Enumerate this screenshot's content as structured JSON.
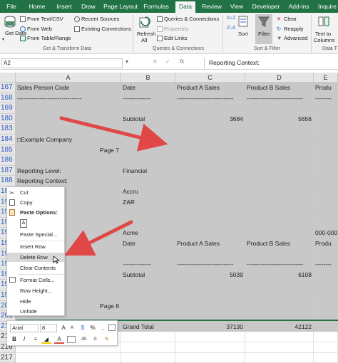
{
  "menu": {
    "tabs": [
      "File",
      "Home",
      "Insert",
      "Draw",
      "Page Layout",
      "Formulas",
      "Data",
      "Review",
      "View",
      "Developer",
      "Add-ins",
      "Inquire"
    ],
    "active": "Data"
  },
  "ribbon": {
    "get_data": "Get Data",
    "from_text_csv": "From Text/CSV",
    "from_web": "From Web",
    "from_table_range": "From Table/Range",
    "recent_sources": "Recent Sources",
    "existing_connections": "Existing Connections",
    "refresh_all_1": "Refresh",
    "refresh_all_2": "All",
    "queries_connections": "Queries & Connections",
    "properties": "Properties",
    "edit_links": "Edit Links",
    "sort": "Sort",
    "filter": "Filter",
    "clear": "Clear",
    "reapply": "Reapply",
    "advanced": "Advanced",
    "text_to_columns_1": "Text to",
    "text_to_columns_2": "Columns",
    "group_get_transform": "Get & Transform Data",
    "group_queries": "Queries & Connections",
    "group_sort_filter": "Sort & Filter",
    "group_data_tools": "Data T"
  },
  "formula_bar": {
    "name_box": "A2",
    "fx": "fx",
    "content": "Reporting Context:"
  },
  "columns": [
    "A",
    "B",
    "C",
    "D",
    "E"
  ],
  "rows": [
    {
      "num": "167",
      "a": "Sales Person Code",
      "b": "Date",
      "c": "Product A Sales",
      "d": "Product B Sales",
      "e": "Produ"
    },
    {
      "num": "168",
      "a": "--------------------------------",
      "b": "--------------",
      "c": "----------------------------",
      "d": "----------------------------",
      "e": "--------"
    },
    {
      "num": "169",
      "a": "",
      "b": "",
      "c": "",
      "d": "",
      "e": ""
    },
    {
      "num": "180",
      "a": "",
      "b": "Subtotal",
      "c": "3684",
      "d": "5656",
      "e": ""
    },
    {
      "num": "183",
      "a": "",
      "b": "",
      "c": "",
      "d": "",
      "e": ""
    },
    {
      "num": "184",
      "a": "□Example Company",
      "b": "",
      "c": "",
      "d": "",
      "e": ""
    },
    {
      "num": "185",
      "a": "Page 7",
      "b": "",
      "c": "",
      "d": "",
      "e": ""
    },
    {
      "num": "186",
      "a": "",
      "b": "",
      "c": "",
      "d": "",
      "e": ""
    },
    {
      "num": "187",
      "a": "Reporting Level:",
      "b": "Financial",
      "c": "",
      "d": "",
      "e": ""
    },
    {
      "num": "188",
      "a": "Reporting Context:",
      "b": "",
      "c": "",
      "d": "",
      "e": ""
    },
    {
      "num": "189",
      "a": "od:",
      "b": "Accru",
      "c": "",
      "d": "",
      "e": ""
    },
    {
      "num": "190",
      "a": "ency:",
      "b": "ZAR",
      "c": "",
      "d": "",
      "e": ""
    },
    {
      "num": "191",
      "a": "any",
      "b": "",
      "c": "",
      "d": "",
      "e": ""
    },
    {
      "num": "192",
      "a": "",
      "b": "",
      "c": "",
      "d": "",
      "e": ""
    },
    {
      "num": "193",
      "a": "",
      "b": "Acme",
      "c": "",
      "d": "",
      "e": "000-000"
    },
    {
      "num": "194",
      "a": "de",
      "b": "Date",
      "c": "Product A Sales",
      "d": "Product B Sales",
      "e": "Produ"
    },
    {
      "num": "195",
      "a": "",
      "b": "",
      "c": "",
      "d": "",
      "e": ""
    },
    {
      "num": "196",
      "a": "",
      "b": "--------------",
      "c": "----------------------------",
      "d": "----------------------------",
      "e": "--------"
    },
    {
      "num": "197",
      "a": "",
      "b": "Subtotal",
      "c": "5039",
      "d": "6108",
      "e": ""
    },
    {
      "num": "198",
      "a": "",
      "b": "",
      "c": "",
      "d": "",
      "e": ""
    },
    {
      "num": "199",
      "a": "any",
      "b": "",
      "c": "",
      "d": "",
      "e": ""
    },
    {
      "num": "200",
      "a": "Page 8",
      "b": "",
      "c": "",
      "d": "",
      "e": ""
    },
    {
      "num": "201",
      "a": "",
      "b": "",
      "c": "",
      "d": "",
      "e": ""
    },
    {
      "num": "214",
      "a": "",
      "b": "Grand Total",
      "c": "37130",
      "d": "42122",
      "e": ""
    },
    {
      "num": "215",
      "a": "",
      "b": "",
      "c": "",
      "d": "",
      "e": ""
    },
    {
      "num": "216",
      "a": "",
      "b": "",
      "c": "",
      "d": "",
      "e": ""
    },
    {
      "num": "217",
      "a": "",
      "b": "",
      "c": "",
      "d": "",
      "e": ""
    }
  ],
  "context_menu": {
    "cut": "Cut",
    "copy": "Copy",
    "paste_options": "Paste Options:",
    "paste_special": "Paste Special...",
    "insert_row": "Insert Row",
    "delete_row": "Delete Row",
    "clear_contents": "Clear Contents",
    "format_cells": "Format Cells...",
    "row_height": "Row Height...",
    "hide": "Hide",
    "unhide": "Unhide"
  },
  "mini_toolbar": {
    "font_name": "Arial",
    "font_size": "8",
    "bold": "B",
    "italic": "I",
    "format_glyph": "A"
  },
  "colors": {
    "excel_green": "#217346",
    "arrow_red": "#e04848",
    "selection_gray": "#c8c8c8",
    "row_number_blue": "#2b57c4"
  }
}
